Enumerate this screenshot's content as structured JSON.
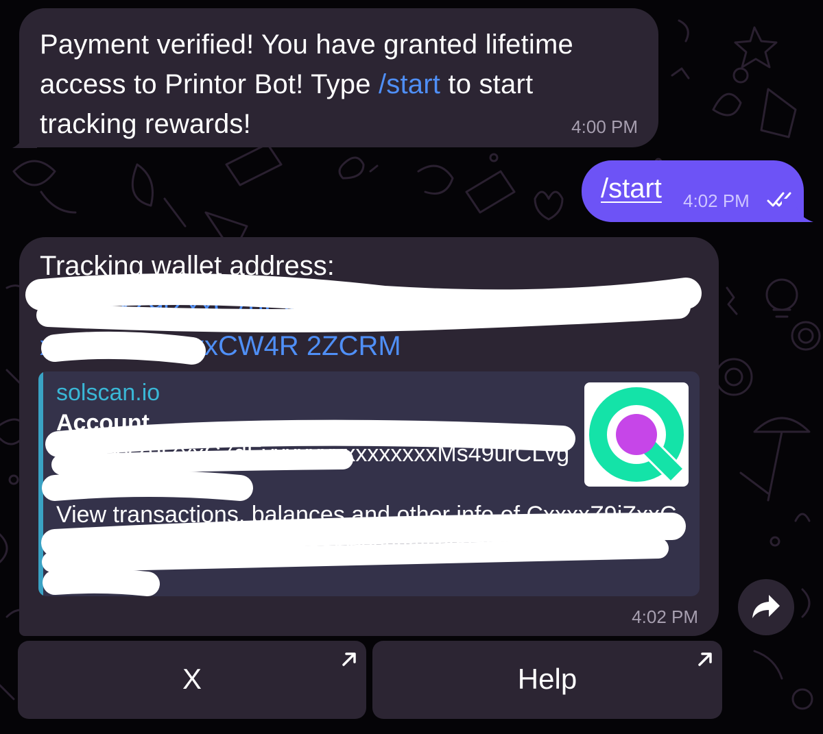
{
  "messages": {
    "payment": {
      "text_before": "Payment verified! You have granted lifetime access to Printor Bot! Type ",
      "command": "/start",
      "text_after": " to start tracking rewards!",
      "time": "4:00 PM"
    },
    "outgoing": {
      "text": "/start",
      "time": "4:02 PM",
      "status_icon": "double-check-icon"
    },
    "wallet": {
      "title": "Tracking wallet address:",
      "address": "BXxxxxZ9iZxxC7dEyxxxx89xT97MxxxxxxxxxxxxxxxxxxxxxxxxxxxxxCW4R 2ZCRM",
      "preview": {
        "site": "solscan.io",
        "title": "Account",
        "account_text": "BXxxxxZ9iZxxC7dEyxxxxxxxxxxxxxxMs49urCLvgC xxxxxxxxxxxx",
        "description": "View transactions, balances and other info of CxxxxZ9iZxxC7dEyxxxxT97Mxxxxxxxxxxxxxxxxxxxxxx2CRM Mxxxxx",
        "thumbnail_icon": "solscan-logo-icon"
      },
      "time": "4:02 PM"
    }
  },
  "keyboard": {
    "buttons": [
      {
        "label": "X",
        "icon": "external-link-arrow-icon"
      },
      {
        "label": "Help",
        "icon": "external-link-arrow-icon"
      }
    ]
  },
  "share_icon": "share-arrow-icon",
  "colors": {
    "background": "#050407",
    "incoming_bubble": "#2c2533",
    "outgoing_bubble": "#6d53f6",
    "link": "#4f8ff7",
    "preview_bg": "#34324a",
    "preview_accent": "#3ab7d6",
    "solscan_green": "#14e3a8",
    "solscan_purple": "#c646e8"
  }
}
